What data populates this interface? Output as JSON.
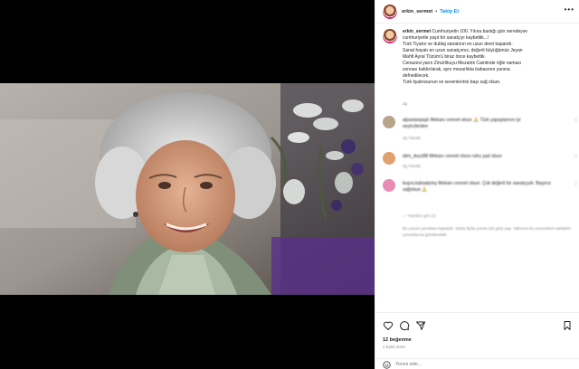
{
  "post": {
    "username": "erkin_sermet",
    "separator": "•",
    "follow_label": "Takip Et",
    "more_icon": "•••"
  },
  "caption": {
    "username": "erkin_sermet",
    "lines": [
      "Cumhuriyetin 100. Yılına bastığı gün neredeyse",
      "cumhuriyetle yaşıt bir sanatçıyı kaybettik...!",
      "Türk Tiyatro ve dublaj sanatının en uzun devri kapandı.",
      "Sanat hayatı en uzun sanatçımız, değerli büyüğümüz Jeyan",
      "Mahfi Ayral Tözüm'ü biraz önce kaybettik.",
      "Cenazesi yarın Zincirlikuyu Mezarlık Camiinde öğle namazı",
      "sonrası kaldırılarak, aynı mezarlıkta babasının yanına",
      "defnedilecek.",
      "Türk tiyatrosunun ve sevenlerinin başı sağ olsun."
    ],
    "time": "2g"
  },
  "comments": [
    {
      "text": "alpaslanpaşlı Mekanı cennet olsun 🙏 Türk yapaylarının iyi",
      "text2": "seyircilerden",
      "meta": "2g   Yanıtla",
      "avatar_color": "#b9a48c"
    },
    {
      "text": "alim_duzz88 Mekanı cennet olsun ruhu şad olsun",
      "text2": "",
      "meta": "2g   Yanıtla",
      "avatar_color": "#e0a070"
    },
    {
      "text": "buşra.bakaalymş Mekanı cennet olsun. Çok değerli bir sanatçıydı. Başınız",
      "text2": "sağolsun 🙏",
      "meta": "2g   Yanıtla",
      "avatar_color": "#e88cb4"
    }
  ],
  "replies_label": "— Yanıtları gör (1)",
  "limit_text": "Bu yorum yanıtlara kapatıldı. Daha fazla yorum için giriş yap. Yalnızca bu yorumların sahipleri yorumlarına gönderebilir.",
  "likes": "12 beğenme",
  "date": "2 Eylül 2023",
  "comment_placeholder": "Yorum ekle...",
  "icons": {
    "more": "more-icon",
    "heart": "heart-icon",
    "comment": "comment-icon",
    "share": "share-icon",
    "save": "bookmark-icon",
    "emoji": "emoji-icon"
  }
}
